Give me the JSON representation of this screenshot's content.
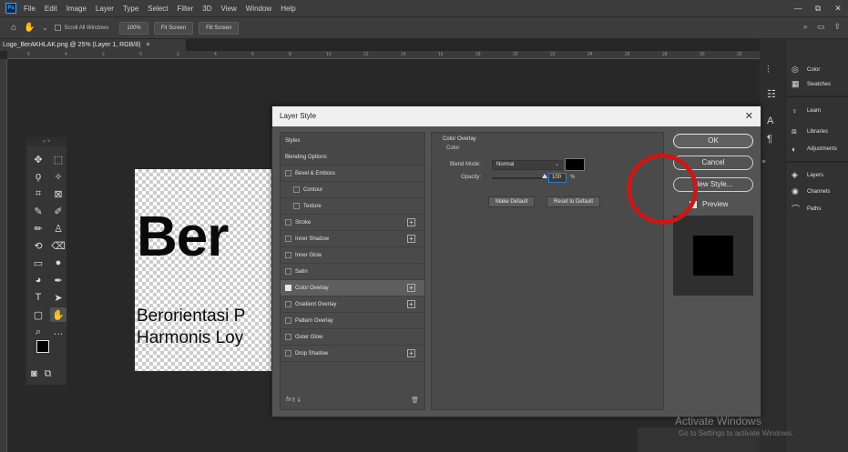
{
  "app": {
    "logo": "Ps"
  },
  "menu": [
    "File",
    "Edit",
    "Image",
    "Layer",
    "Type",
    "Select",
    "Filter",
    "3D",
    "View",
    "Window",
    "Help"
  ],
  "window_controls": [
    "—",
    "⧉",
    "✕"
  ],
  "options": {
    "scroll_all": "Scroll All Windows",
    "zoom": "100%",
    "fit_screen": "Fit Screen",
    "fill_screen": "Fill Screen"
  },
  "document": {
    "tab_title": "Logo_BerAKHLAK.png @ 25% (Layer 1, RGB/8)",
    "tab_close": "×"
  },
  "ruler": [
    "6",
    "4",
    "2",
    "0",
    "2",
    "4",
    "6",
    "8",
    "10",
    "12",
    "14",
    "16",
    "18",
    "20",
    "22",
    "24",
    "26",
    "28",
    "30",
    "32"
  ],
  "canvas": {
    "big_text": "Ber",
    "line1": "Berorientasi P",
    "line2": "Harmonis Loy"
  },
  "toolbar_head": "« ×",
  "right_panel": {
    "color": "Color",
    "swatches": "Swatches",
    "learn": "Learn",
    "libraries": "Libraries",
    "adjustments": "Adjustments",
    "layers": "Layers",
    "channels": "Channels",
    "paths": "Paths"
  },
  "layers_strip": "›› | ≡",
  "dialog": {
    "title": "Layer Style",
    "close": "✕",
    "styles": [
      {
        "label": "Styles",
        "type": "header"
      },
      {
        "label": "Blending Options",
        "type": "header"
      },
      {
        "label": "Bevel & Emboss",
        "checked": false
      },
      {
        "label": "Contour",
        "checked": false,
        "indent": true
      },
      {
        "label": "Texture",
        "checked": false,
        "indent": true
      },
      {
        "label": "Stroke",
        "checked": false,
        "plus": true
      },
      {
        "label": "Inner Shadow",
        "checked": false,
        "plus": true
      },
      {
        "label": "Inner Glow",
        "checked": false
      },
      {
        "label": "Satin",
        "checked": false
      },
      {
        "label": "Color Overlay",
        "checked": true,
        "plus": true,
        "selected": true
      },
      {
        "label": "Gradient Overlay",
        "checked": false,
        "plus": true
      },
      {
        "label": "Pattern Overlay",
        "checked": false
      },
      {
        "label": "Outer Glow",
        "checked": false
      },
      {
        "label": "Drop Shadow",
        "checked": false,
        "plus": true
      }
    ],
    "footer": {
      "fx": "fx",
      "up": "⇑",
      "down": "⇓",
      "trash": "🗑"
    },
    "overlay": {
      "group": "Color Overlay",
      "sub": "Color",
      "blend_label": "Blend Mode:",
      "blend_value": "Normal",
      "opacity_label": "Opacity:",
      "opacity_value": "100",
      "pct": "%",
      "make_default": "Make Default",
      "reset_default": "Reset to Default",
      "color": "#000000"
    },
    "buttons": {
      "ok": "OK",
      "cancel": "Cancel",
      "new_style": "New Style...",
      "preview": "Preview"
    }
  },
  "watermark": {
    "line1": "Activate Windows",
    "line2": "Go to Settings to activate Windows."
  },
  "accent": "#c41a1a"
}
